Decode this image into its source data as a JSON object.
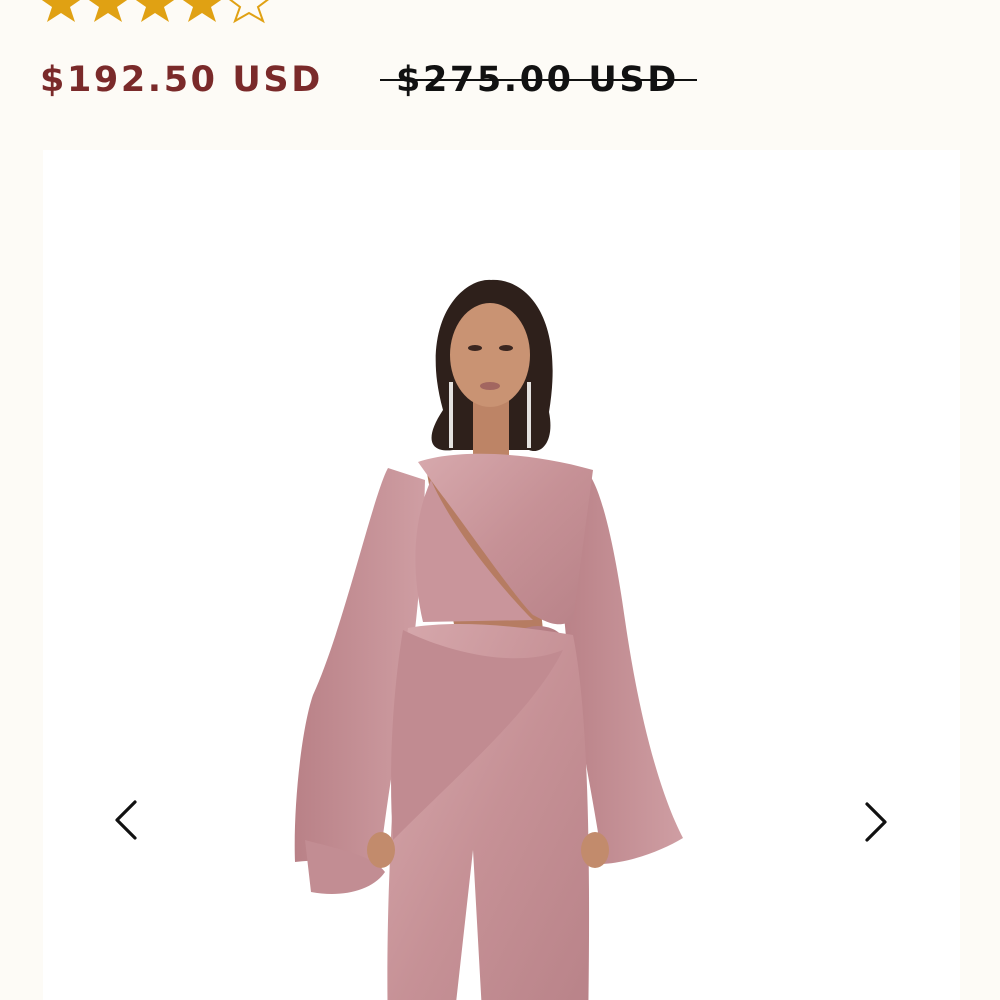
{
  "rating": {
    "value": 4,
    "max": 5,
    "filled_color": "#e0a113",
    "empty_color": "#e0a113"
  },
  "pricing": {
    "sale_price": "$192.50 USD",
    "compare_at_price": "$275.00 USD",
    "sale_color": "#7a2a2a"
  },
  "gallery": {
    "image_description_icon": "product-photo",
    "prev_icon": "chevron-left-icon",
    "next_icon": "chevron-right-icon",
    "product_color": "#c9959c"
  }
}
